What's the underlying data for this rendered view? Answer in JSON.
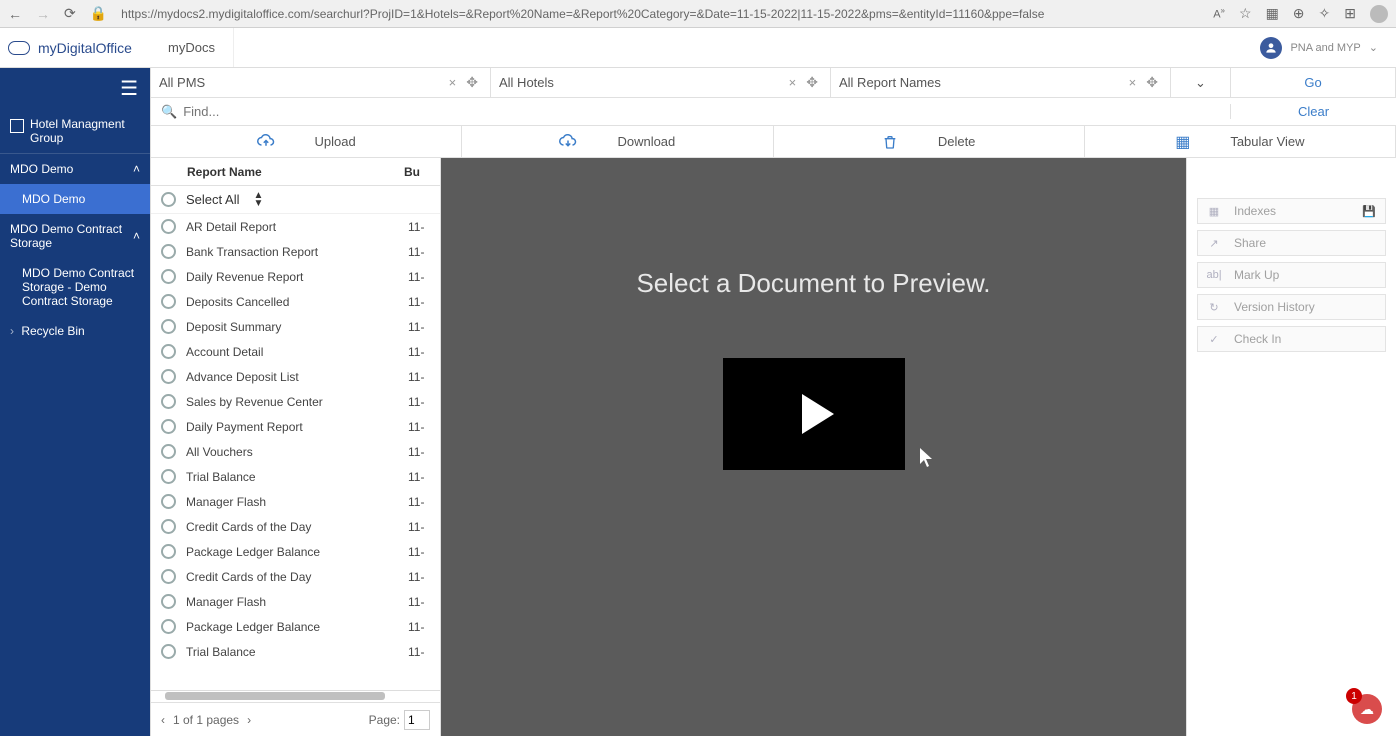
{
  "browser": {
    "url": "https://mydocs2.mydigitaloffice.com/searchurl?ProjID=1&Hotels=&Report%20Name=&Report%20Category=&Date=11-15-2022|11-15-2022&pms=&entityId=11160&ppe=false",
    "zoom_label": "A"
  },
  "app": {
    "brand": "myDigitalOffice",
    "tab": "myDocs",
    "user_label": "PNA and MYP"
  },
  "sidebar": {
    "group_title": "Hotel Managment Group",
    "sections": [
      {
        "header": "MDO Demo",
        "children": [
          "MDO Demo"
        ],
        "active_child": 0
      },
      {
        "header": "MDO Demo Contract Storage",
        "children": [
          "MDO Demo Contract Storage - Demo Contract Storage"
        ]
      }
    ],
    "recycle": "Recycle Bin"
  },
  "filters": {
    "pms": "All PMS",
    "hotels": "All Hotels",
    "reports": "All Report Names",
    "go": "Go",
    "clear": "Clear"
  },
  "search": {
    "placeholder": "Find..."
  },
  "actions": {
    "upload": "Upload",
    "download": "Download",
    "delete": "Delete",
    "tabular": "Tabular View"
  },
  "report_list": {
    "col_name": "Report Name",
    "col_bu": "Bu",
    "select_all": "Select All",
    "rows": [
      {
        "name": "AR Detail Report",
        "d": "11-"
      },
      {
        "name": "Bank Transaction Report",
        "d": "11-"
      },
      {
        "name": "Daily Revenue Report",
        "d": "11-"
      },
      {
        "name": "Deposits Cancelled",
        "d": "11-"
      },
      {
        "name": "Deposit Summary",
        "d": "11-"
      },
      {
        "name": "Account Detail",
        "d": "11-"
      },
      {
        "name": "Advance Deposit List",
        "d": "11-"
      },
      {
        "name": "Sales by Revenue Center",
        "d": "11-"
      },
      {
        "name": "Daily Payment Report",
        "d": "11-"
      },
      {
        "name": "All Vouchers",
        "d": "11-"
      },
      {
        "name": "Trial Balance",
        "d": "11-"
      },
      {
        "name": "Manager Flash",
        "d": "11-"
      },
      {
        "name": "Credit Cards of the Day",
        "d": "11-"
      },
      {
        "name": "Package Ledger Balance",
        "d": "11-"
      },
      {
        "name": "Credit Cards of the Day",
        "d": "11-"
      },
      {
        "name": "Manager Flash",
        "d": "11-"
      },
      {
        "name": "Package Ledger Balance",
        "d": "11-"
      },
      {
        "name": "Trial Balance",
        "d": "11-"
      }
    ],
    "pager_text": "1 of 1 pages",
    "page_label": "Page:",
    "page_value": "1"
  },
  "preview": {
    "message": "Select a Document to Preview."
  },
  "right_panel": {
    "items": [
      "Indexes",
      "Share",
      "Mark Up",
      "Version History",
      "Check In"
    ],
    "icons": [
      "▦",
      "↗",
      "ab|",
      "↻",
      "✓"
    ]
  },
  "badge": {
    "count": "1"
  }
}
